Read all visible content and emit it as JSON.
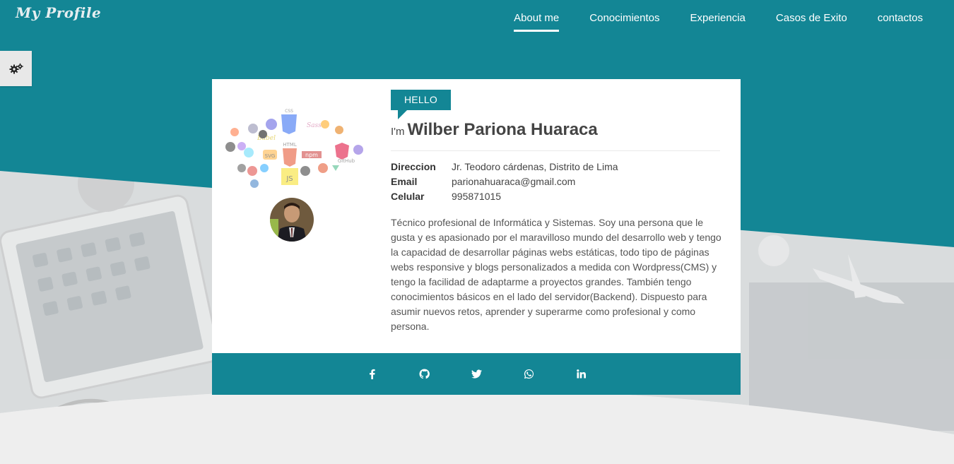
{
  "brand": {
    "logo": "My Profile"
  },
  "nav": {
    "items": [
      {
        "label": "About me",
        "active": true
      },
      {
        "label": "Conocimientos"
      },
      {
        "label": "Experiencia"
      },
      {
        "label": "Casos de Exito"
      },
      {
        "label": "contactos"
      }
    ]
  },
  "settings": {
    "icon": "gears-icon"
  },
  "profile": {
    "hello": "HELLO",
    "im": "I'm",
    "name": "Wilber Pariona Huaraca",
    "info": [
      {
        "label": "Direccion",
        "value": "Jr. Teodoro cárdenas, Distrito de Lima"
      },
      {
        "label": "Email",
        "value": "parionahuaraca@gmail.com"
      },
      {
        "label": "Celular",
        "value": "995871015"
      }
    ],
    "bio": "Técnico profesional de Informática y Sistemas. Soy una persona que le gusta y es apasionado por el maravilloso mundo del desarrollo web y tengo la capacidad de desarrollar páginas webs estáticas, todo tipo de páginas webs responsive y blogs personalizados a medida con Wordpress(CMS) y tengo la facilidad de adaptarme a proyectos grandes. También tengo conocimientos básicos en el lado del servidor(Backend). Dispuesto para asumir nuevos retos, aprender y superarme como profesional y como persona.",
    "tech_labels": [
      "CSS",
      "HTML",
      "npm",
      "GitHub",
      "JS",
      "Sass",
      "SVG",
      "Babel"
    ]
  },
  "social": [
    "facebook-icon",
    "github-icon",
    "twitter-icon",
    "whatsapp-icon",
    "linkedin-icon"
  ],
  "colors": {
    "primary": "#138695",
    "background": "#eeeeee",
    "card": "#ffffff",
    "text": "#444444"
  }
}
